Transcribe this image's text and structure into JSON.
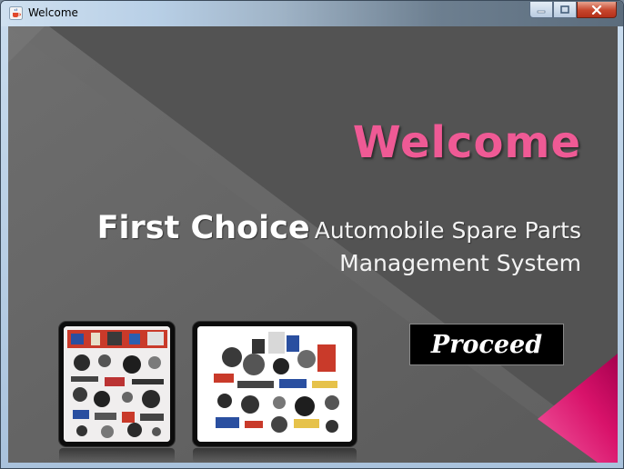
{
  "window": {
    "title": "Welcome",
    "icon": "java-cup-icon",
    "controls": [
      "minimize",
      "maximize",
      "close"
    ]
  },
  "main": {
    "heading": "Welcome",
    "brand": "First Choice",
    "subtitle_line1": "Automobile Spare Parts",
    "subtitle_line2": "Management System",
    "proceed_label": "Proceed"
  },
  "images": [
    {
      "name": "spare-parts-photo-1",
      "subject": "assorted car spare parts"
    },
    {
      "name": "spare-parts-photo-2",
      "subject": "assorted car spare parts"
    }
  ],
  "colors": {
    "heading": "#ef5a95",
    "accent_triangle": "#e0186a",
    "background": "#575757",
    "button_bg": "#000000"
  }
}
